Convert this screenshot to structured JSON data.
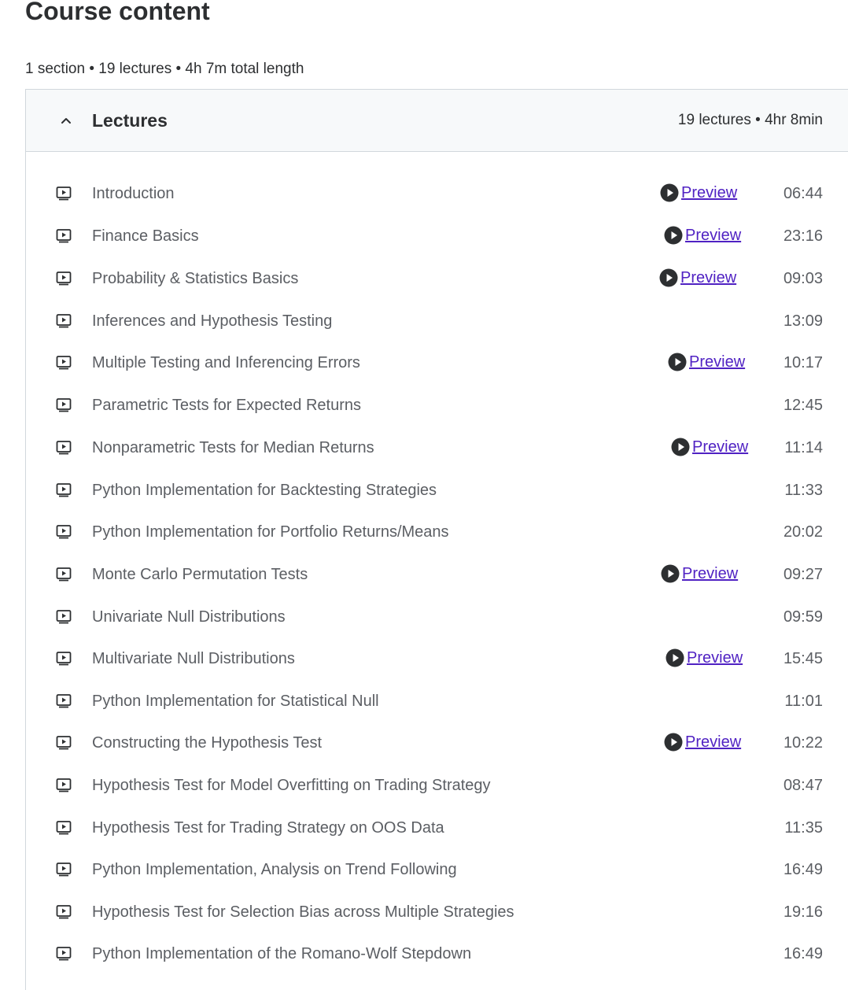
{
  "header": {
    "title": "Course content",
    "summary": "1 section • 19 lectures • 4h 7m total length"
  },
  "section": {
    "title": "Lectures",
    "meta": "19 lectures • 4hr 8min",
    "expanded": true,
    "chevron_icon": "chevron-up-icon"
  },
  "colors": {
    "accent_link": "#5022c3",
    "text_primary": "#2d2f31",
    "text_secondary": "#5b5e63",
    "header_bg": "#f7f9fa",
    "border": "#d1d7dc"
  },
  "lecture_icon": "video-play-icon",
  "preview_icon": "play-circle-icon",
  "lectures": [
    {
      "title": "Introduction",
      "duration": "06:44",
      "preview": "Preview"
    },
    {
      "title": "Finance Basics",
      "duration": "23:16",
      "preview": "Preview"
    },
    {
      "title": "Probability & Statistics Basics",
      "duration": "09:03",
      "preview": "Preview"
    },
    {
      "title": "Inferences and Hypothesis Testing",
      "duration": "13:09",
      "preview": null
    },
    {
      "title": "Multiple Testing and Inferencing Errors",
      "duration": "10:17",
      "preview": "Preview"
    },
    {
      "title": "Parametric Tests for Expected Returns",
      "duration": "12:45",
      "preview": null
    },
    {
      "title": "Nonparametric Tests for Median Returns",
      "duration": "11:14",
      "preview": "Preview"
    },
    {
      "title": "Python Implementation for Backtesting Strategies",
      "duration": "11:33",
      "preview": null
    },
    {
      "title": "Python Implementation for Portfolio Returns/Means",
      "duration": "20:02",
      "preview": null
    },
    {
      "title": "Monte Carlo Permutation Tests",
      "duration": "09:27",
      "preview": "Preview"
    },
    {
      "title": "Univariate Null Distributions",
      "duration": "09:59",
      "preview": null
    },
    {
      "title": "Multivariate Null Distributions",
      "duration": "15:45",
      "preview": "Preview"
    },
    {
      "title": "Python Implementation for Statistical Null",
      "duration": "11:01",
      "preview": null
    },
    {
      "title": "Constructing the Hypothesis Test",
      "duration": "10:22",
      "preview": "Preview"
    },
    {
      "title": "Hypothesis Test for Model Overfitting on Trading Strategy",
      "duration": "08:47",
      "preview": null
    },
    {
      "title": "Hypothesis Test for Trading Strategy on OOS Data",
      "duration": "11:35",
      "preview": null
    },
    {
      "title": "Python Implementation, Analysis on Trend Following",
      "duration": "16:49",
      "preview": null
    },
    {
      "title": "Hypothesis Test for Selection Bias across Multiple Strategies",
      "duration": "19:16",
      "preview": null
    },
    {
      "title": "Python Implementation of the Romano-Wolf Stepdown",
      "duration": "16:49",
      "preview": null
    }
  ]
}
